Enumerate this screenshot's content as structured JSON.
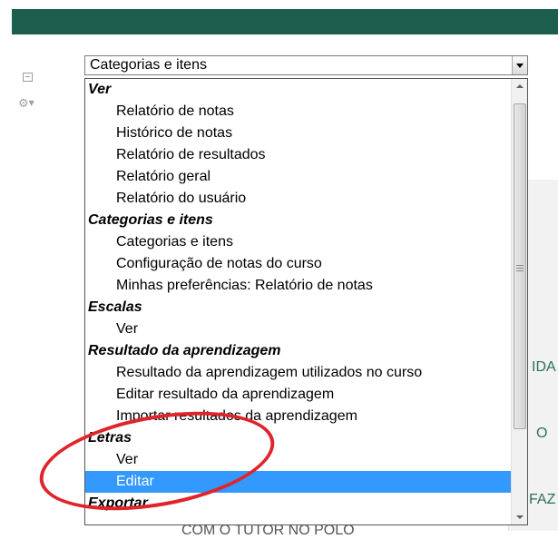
{
  "select": {
    "value": "Categorias e itens"
  },
  "background": {
    "text_1": "IDA",
    "text_2": "O",
    "text_3": "FAZ",
    "text_4": "COM O TUTOR NO POLO"
  },
  "dropdown": {
    "rows": [
      {
        "label": "Ver",
        "type": "group"
      },
      {
        "label": "Relatório de notas",
        "type": "option"
      },
      {
        "label": "Histórico de notas",
        "type": "option"
      },
      {
        "label": "Relatório de resultados",
        "type": "option"
      },
      {
        "label": "Relatório geral",
        "type": "option"
      },
      {
        "label": "Relatório do usuário",
        "type": "option"
      },
      {
        "label": "Categorias e itens",
        "type": "group"
      },
      {
        "label": "Categorias e itens",
        "type": "option"
      },
      {
        "label": "Configuração de notas do curso",
        "type": "option"
      },
      {
        "label": "Minhas preferências: Relatório de notas",
        "type": "option"
      },
      {
        "label": "Escalas",
        "type": "group"
      },
      {
        "label": "Ver",
        "type": "option"
      },
      {
        "label": "Resultado da aprendizagem",
        "type": "group"
      },
      {
        "label": "Resultado da aprendizagem utilizados no curso",
        "type": "option"
      },
      {
        "label": "Editar resultado da aprendizagem",
        "type": "option"
      },
      {
        "label": "Importar resultados da aprendizagem",
        "type": "option"
      },
      {
        "label": "Letras",
        "type": "group"
      },
      {
        "label": "Ver",
        "type": "option"
      },
      {
        "label": "Editar",
        "type": "option",
        "selected": true
      },
      {
        "label": "Exportar",
        "type": "group"
      }
    ]
  },
  "colors": {
    "header": "#1d5e4e",
    "selection": "#3399ff",
    "annotation": "#e0242b"
  }
}
